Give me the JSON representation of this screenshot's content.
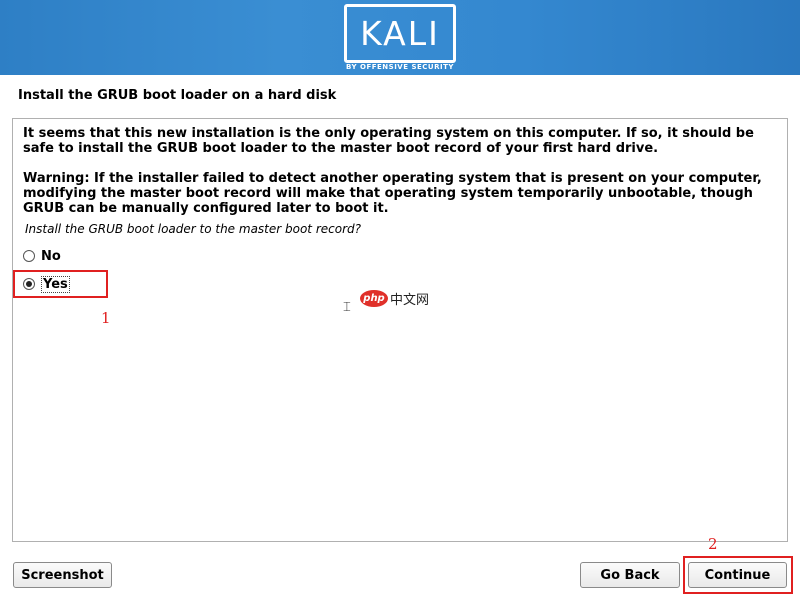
{
  "banner": {
    "logo": "KALI",
    "tagline": "BY OFFENSIVE SECURITY"
  },
  "page": {
    "title": "Install the GRUB boot loader on a hard disk"
  },
  "content": {
    "paragraph1": "It seems that this new installation is the only operating system on this computer. If so, it should be safe to install the GRUB boot loader to the master boot record of your first hard drive.",
    "paragraph2": "Warning: If the installer failed to detect another operating system that is present on your computer, modifying the master boot record will make that operating system temporarily unbootable, though GRUB can be manually configured later to boot it.",
    "question": "Install the GRUB boot loader to the master boot record?",
    "options": [
      {
        "label": "No",
        "selected": false
      },
      {
        "label": "Yes",
        "selected": true
      }
    ]
  },
  "annotations": {
    "one": "1",
    "two": "2",
    "color": "#e02020"
  },
  "watermark": {
    "badge": "php",
    "text": "中文网"
  },
  "buttons": {
    "screenshot": "Screenshot",
    "go_back": "Go Back",
    "continue": "Continue"
  },
  "colors": {
    "banner": "#3488d0",
    "border": "#b0b0b0"
  }
}
